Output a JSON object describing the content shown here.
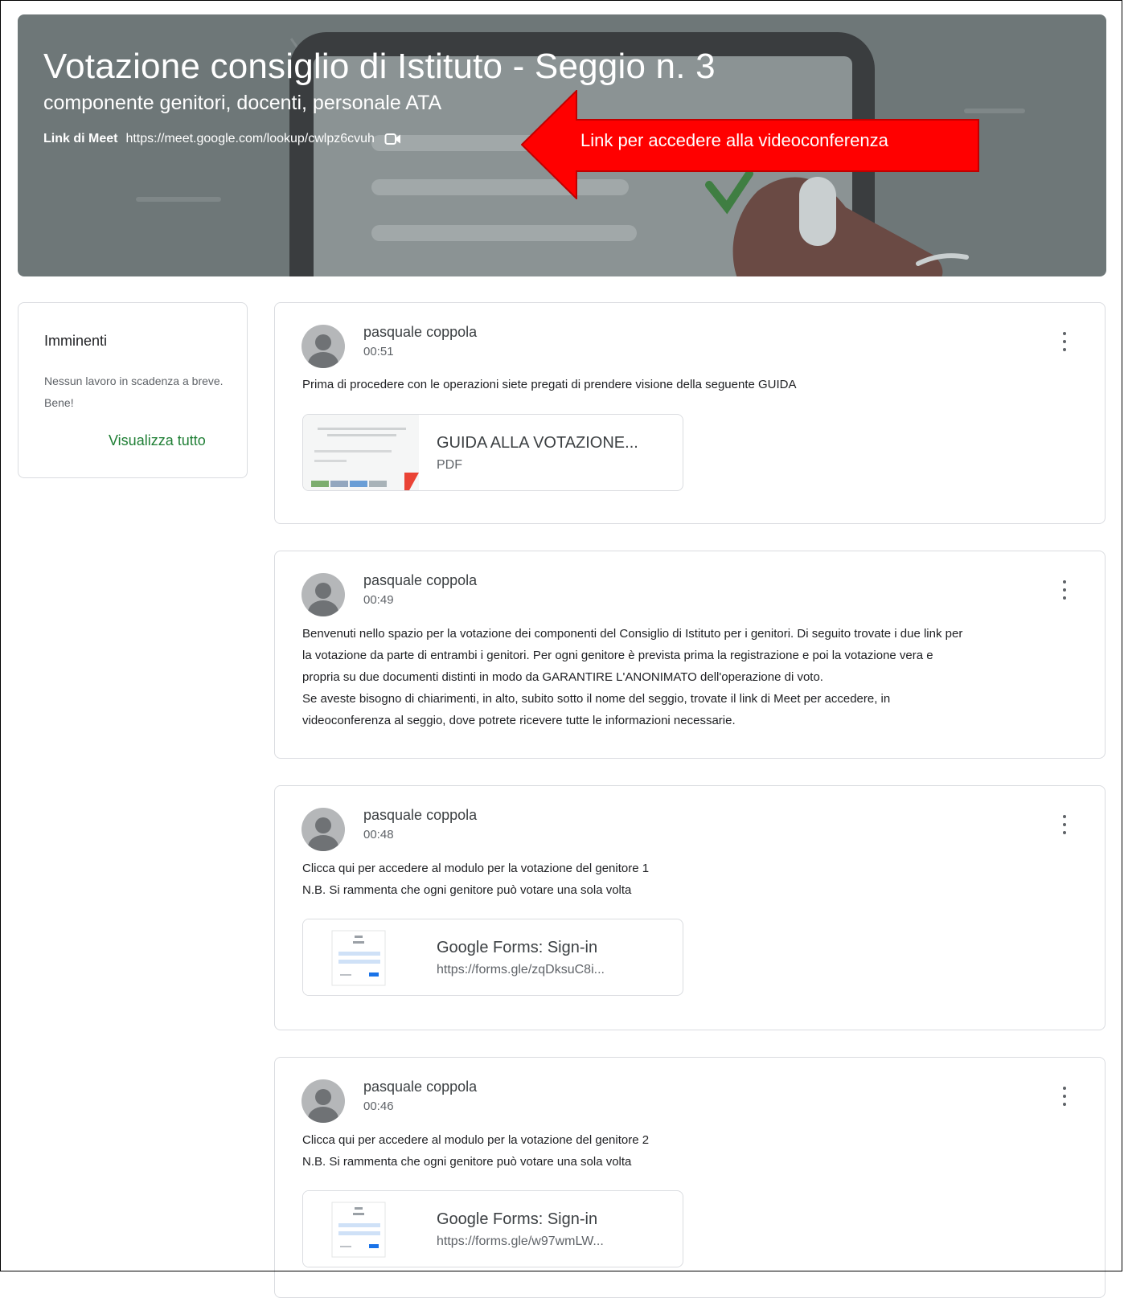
{
  "header": {
    "title": "Votazione consiglio di Istituto - Seggio n. 3",
    "subtitle": "componente genitori, docenti, personale ATA",
    "meet_label": "Link di Meet",
    "meet_url": "https://meet.google.com/lookup/cwlpz6cvuh",
    "meet_icon": "video-camera-icon"
  },
  "annotation": {
    "text": "Link per accedere alla videoconferenza",
    "color": "#ff0000"
  },
  "upcoming": {
    "title": "Imminenti",
    "empty_text": "Nessun lavoro in scadenza a breve. Bene!",
    "view_all": "Visualizza tutto"
  },
  "posts": [
    {
      "author": "pasquale coppola",
      "time": "00:51",
      "lines": [
        "Prima di procedere con le operazioni siete pregati di prendere visione della seguente GUIDA"
      ],
      "attachment": {
        "title": "GUIDA ALLA VOTAZIONE...",
        "subtitle": "PDF"
      }
    },
    {
      "author": "pasquale coppola",
      "time": "00:49",
      "lines": [
        "Benvenuti nello spazio per la votazione dei componenti del Consiglio di Istituto per i genitori. Di seguito trovate i due link per",
        "la votazione da parte di entrambi i genitori. Per ogni genitore è prevista prima la registrazione e poi la votazione vera e",
        "propria su due documenti distinti in modo da GARANTIRE L'ANONIMATO dell'operazione di voto.",
        "Se aveste bisogno di chiarimenti, in alto, subito sotto il nome del seggio, trovate il link di Meet per accedere, in",
        "videoconferenza al seggio, dove potrete ricevere tutte le informazioni necessarie."
      ]
    },
    {
      "author": "pasquale coppola",
      "time": "00:48",
      "lines": [
        "Clicca qui per accedere al modulo per la votazione del genitore 1",
        "N.B. Si rammenta che ogni genitore può votare una sola volta"
      ],
      "attachment": {
        "title": "Google Forms: Sign-in",
        "subtitle": "https://forms.gle/zqDksuC8i..."
      }
    },
    {
      "author": "pasquale coppola",
      "time": "00:46",
      "lines": [
        "Clicca qui per accedere al modulo per la votazione del genitore 2",
        "N.B. Si rammenta che ogni genitore può votare una sola volta"
      ],
      "attachment": {
        "title": "Google Forms: Sign-in",
        "subtitle": "https://forms.gle/w97wmLW..."
      }
    }
  ]
}
